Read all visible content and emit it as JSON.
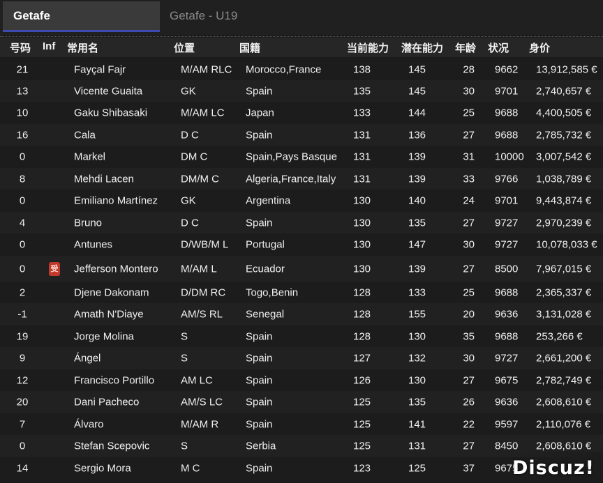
{
  "tabs": [
    {
      "label": "Getafe",
      "active": true
    },
    {
      "label": "Getafe - U19",
      "active": false
    }
  ],
  "columns": {
    "num": "号码",
    "inf": "Inf",
    "name": "常用名",
    "position": "位置",
    "nationality": "国籍",
    "current_ability": "当前能力",
    "potential_ability": "潜在能力",
    "age": "年龄",
    "status": "状况",
    "value": "身价"
  },
  "players": [
    {
      "num": "21",
      "inf": "",
      "name": "Fayçal Fajr",
      "position": "M/AM RLC",
      "nationality": "Morocco,France",
      "ca": "138",
      "pa": "145",
      "age": "28",
      "status": "9662",
      "value": "13,912,585 €"
    },
    {
      "num": "13",
      "inf": "",
      "name": "Vicente Guaita",
      "position": "GK",
      "nationality": "Spain",
      "ca": "135",
      "pa": "145",
      "age": "30",
      "status": "9701",
      "value": "2,740,657 €"
    },
    {
      "num": "10",
      "inf": "",
      "name": "Gaku Shibasaki",
      "position": "M/AM LC",
      "nationality": "Japan",
      "ca": "133",
      "pa": "144",
      "age": "25",
      "status": "9688",
      "value": "4,400,505 €"
    },
    {
      "num": "16",
      "inf": "",
      "name": "Cala",
      "position": "D C",
      "nationality": "Spain",
      "ca": "131",
      "pa": "136",
      "age": "27",
      "status": "9688",
      "value": "2,785,732 €"
    },
    {
      "num": "0",
      "inf": "",
      "name": "Markel",
      "position": "DM C",
      "nationality": "Spain,Pays Basque",
      "ca": "131",
      "pa": "139",
      "age": "31",
      "status": "10000",
      "value": "3,007,542 €"
    },
    {
      "num": "8",
      "inf": "",
      "name": "Mehdi Lacen",
      "position": "DM/M C",
      "nationality": "Algeria,France,Italy",
      "ca": "131",
      "pa": "139",
      "age": "33",
      "status": "9766",
      "value": "1,038,789 €"
    },
    {
      "num": "0",
      "inf": "",
      "name": "Emiliano Martínez",
      "position": "GK",
      "nationality": "Argentina",
      "ca": "130",
      "pa": "140",
      "age": "24",
      "status": "9701",
      "value": "9,443,874 €"
    },
    {
      "num": "4",
      "inf": "",
      "name": "Bruno",
      "position": "D C",
      "nationality": "Spain",
      "ca": "130",
      "pa": "135",
      "age": "27",
      "status": "9727",
      "value": "2,970,239 €"
    },
    {
      "num": "0",
      "inf": "",
      "name": "Antunes",
      "position": "D/WB/M L",
      "nationality": "Portugal",
      "ca": "130",
      "pa": "147",
      "age": "30",
      "status": "9727",
      "value": "10,078,033 €"
    },
    {
      "num": "0",
      "inf": "受",
      "name": "Jefferson Montero",
      "position": "M/AM L",
      "nationality": "Ecuador",
      "ca": "130",
      "pa": "139",
      "age": "27",
      "status": "8500",
      "value": "7,967,015 €"
    },
    {
      "num": "2",
      "inf": "",
      "name": "Djene Dakonam",
      "position": "D/DM RC",
      "nationality": "Togo,Benin",
      "ca": "128",
      "pa": "133",
      "age": "25",
      "status": "9688",
      "value": "2,365,337 €"
    },
    {
      "num": "-1",
      "inf": "",
      "name": "Amath N'Diaye",
      "position": "AM/S RL",
      "nationality": "Senegal",
      "ca": "128",
      "pa": "155",
      "age": "20",
      "status": "9636",
      "value": "3,131,028 €"
    },
    {
      "num": "19",
      "inf": "",
      "name": "Jorge Molina",
      "position": "S",
      "nationality": "Spain",
      "ca": "128",
      "pa": "130",
      "age": "35",
      "status": "9688",
      "value": "253,266 €"
    },
    {
      "num": "9",
      "inf": "",
      "name": "Ángel",
      "position": "S",
      "nationality": "Spain",
      "ca": "127",
      "pa": "132",
      "age": "30",
      "status": "9727",
      "value": "2,661,200 €"
    },
    {
      "num": "12",
      "inf": "",
      "name": "Francisco Portillo",
      "position": "AM LC",
      "nationality": "Spain",
      "ca": "126",
      "pa": "130",
      "age": "27",
      "status": "9675",
      "value": "2,782,749 €"
    },
    {
      "num": "20",
      "inf": "",
      "name": "Dani Pacheco",
      "position": "AM/S LC",
      "nationality": "Spain",
      "ca": "125",
      "pa": "135",
      "age": "26",
      "status": "9636",
      "value": "2,608,610 €"
    },
    {
      "num": "7",
      "inf": "",
      "name": "Álvaro",
      "position": "M/AM R",
      "nationality": "Spain",
      "ca": "125",
      "pa": "141",
      "age": "22",
      "status": "9597",
      "value": "2,110,076 €"
    },
    {
      "num": "0",
      "inf": "",
      "name": "Stefan Scepovic",
      "position": "S",
      "nationality": "Serbia",
      "ca": "125",
      "pa": "131",
      "age": "27",
      "status": "8450",
      "value": "2,608,610 €"
    },
    {
      "num": "14",
      "inf": "",
      "name": "Sergio Mora",
      "position": "M C",
      "nationality": "Spain",
      "ca": "123",
      "pa": "125",
      "age": "37",
      "status": "9675",
      "value": ""
    }
  ],
  "watermark": "Discuz!"
}
